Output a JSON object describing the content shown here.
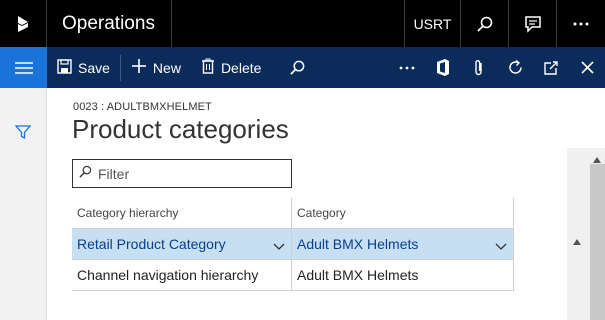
{
  "app": {
    "title": "Operations",
    "company": "USRT"
  },
  "toolbar": {
    "save_label": "Save",
    "new_label": "New",
    "delete_label": "Delete"
  },
  "page": {
    "caption": "0023 : ADULTBMXHELMET",
    "title": "Product categories"
  },
  "filter": {
    "placeholder": "Filter",
    "value": ""
  },
  "grid": {
    "headers": [
      "Category hierarchy",
      "Category"
    ],
    "rows": [
      {
        "hierarchy": "Retail Product Category",
        "category": "Adult BMX Helmets",
        "selected": true
      },
      {
        "hierarchy": "Channel navigation hierarchy",
        "category": "Adult BMX Helmets",
        "selected": false
      }
    ]
  },
  "colors": {
    "top_bar": "#000000",
    "action_bar": "#0b2b5a",
    "accent": "#1a73d9",
    "selected_row": "#c6dff3"
  }
}
